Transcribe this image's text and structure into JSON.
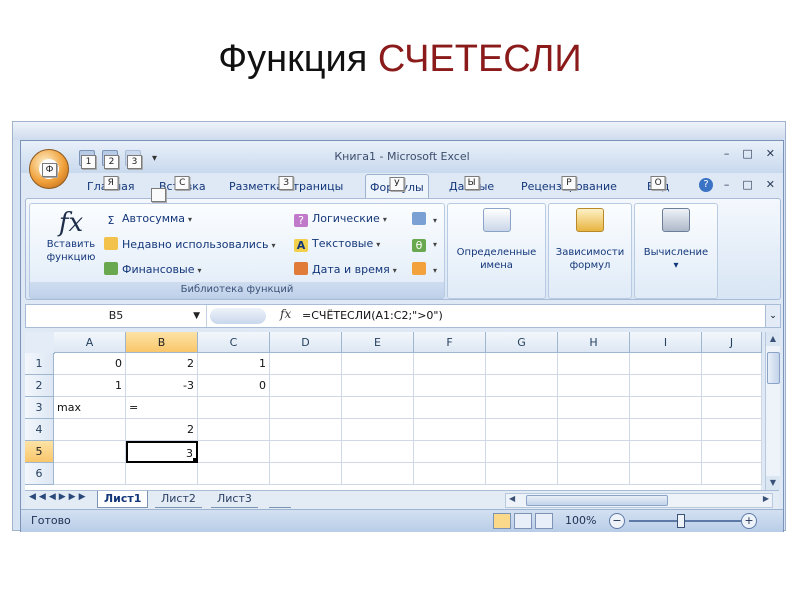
{
  "slide": {
    "title_plain": "Функция",
    "title_accent": "СЧЕТЕСЛИ"
  },
  "window": {
    "title": "Книга1 - Microsoft Excel",
    "office_button_keytip": "Ф",
    "qat": [
      {
        "keytip": "1"
      },
      {
        "keytip": "2"
      },
      {
        "keytip": "3"
      }
    ],
    "controls": [
      "–",
      "□",
      "✕"
    ]
  },
  "tabs": [
    {
      "label": "Главная",
      "keytip": "Я"
    },
    {
      "label": "Вставка",
      "keytip": "С"
    },
    {
      "label": "Разметка страницы",
      "keytip": "З"
    },
    {
      "label": "Формулы",
      "keytip": "У"
    },
    {
      "label": "Данные",
      "keytip": "Ы"
    },
    {
      "label": "Рецензирование",
      "keytip": "Р"
    },
    {
      "label": "Вид",
      "keytip": "О"
    }
  ],
  "ribbon": {
    "insert_function": {
      "glyph": "fx",
      "line1": "Вставить",
      "line2": "функцию"
    },
    "library": {
      "autosum": "Автосумма",
      "recent": "Недавно использовались",
      "financial": "Финансовые",
      "logical": "Логические",
      "text": "Текстовые",
      "datetime": "Дата и время",
      "group_label": "Библиотека функций"
    },
    "defined_names": {
      "line1": "Определенные",
      "line2": "имена"
    },
    "dependencies": {
      "line1": "Зависимости",
      "line2": "формул"
    },
    "calculation": {
      "line1": "Вычисление"
    }
  },
  "formula_bar": {
    "name_box": "B5",
    "fx": "fx",
    "formula": "=СЧЁТЕСЛИ(A1:C2;\">0\")"
  },
  "sheet": {
    "columns": [
      "A",
      "B",
      "C",
      "D",
      "E",
      "F",
      "G",
      "H",
      "I",
      "J"
    ],
    "selected_column": "B",
    "rows": [
      "1",
      "2",
      "3",
      "4",
      "5",
      "6"
    ],
    "selected_row": "5",
    "cells": {
      "A1": "0",
      "B1": "2",
      "C1": "1",
      "A2": "1",
      "B2": "-3",
      "C2": "0",
      "A3": "max",
      "B3": "=",
      "B4": "2",
      "B5": "3"
    }
  },
  "sheet_tabs": [
    {
      "label": "Лист1"
    },
    {
      "label": "Лист2"
    },
    {
      "label": "Лист3"
    }
  ],
  "status": {
    "ready": "Готово",
    "zoom": "100%"
  }
}
